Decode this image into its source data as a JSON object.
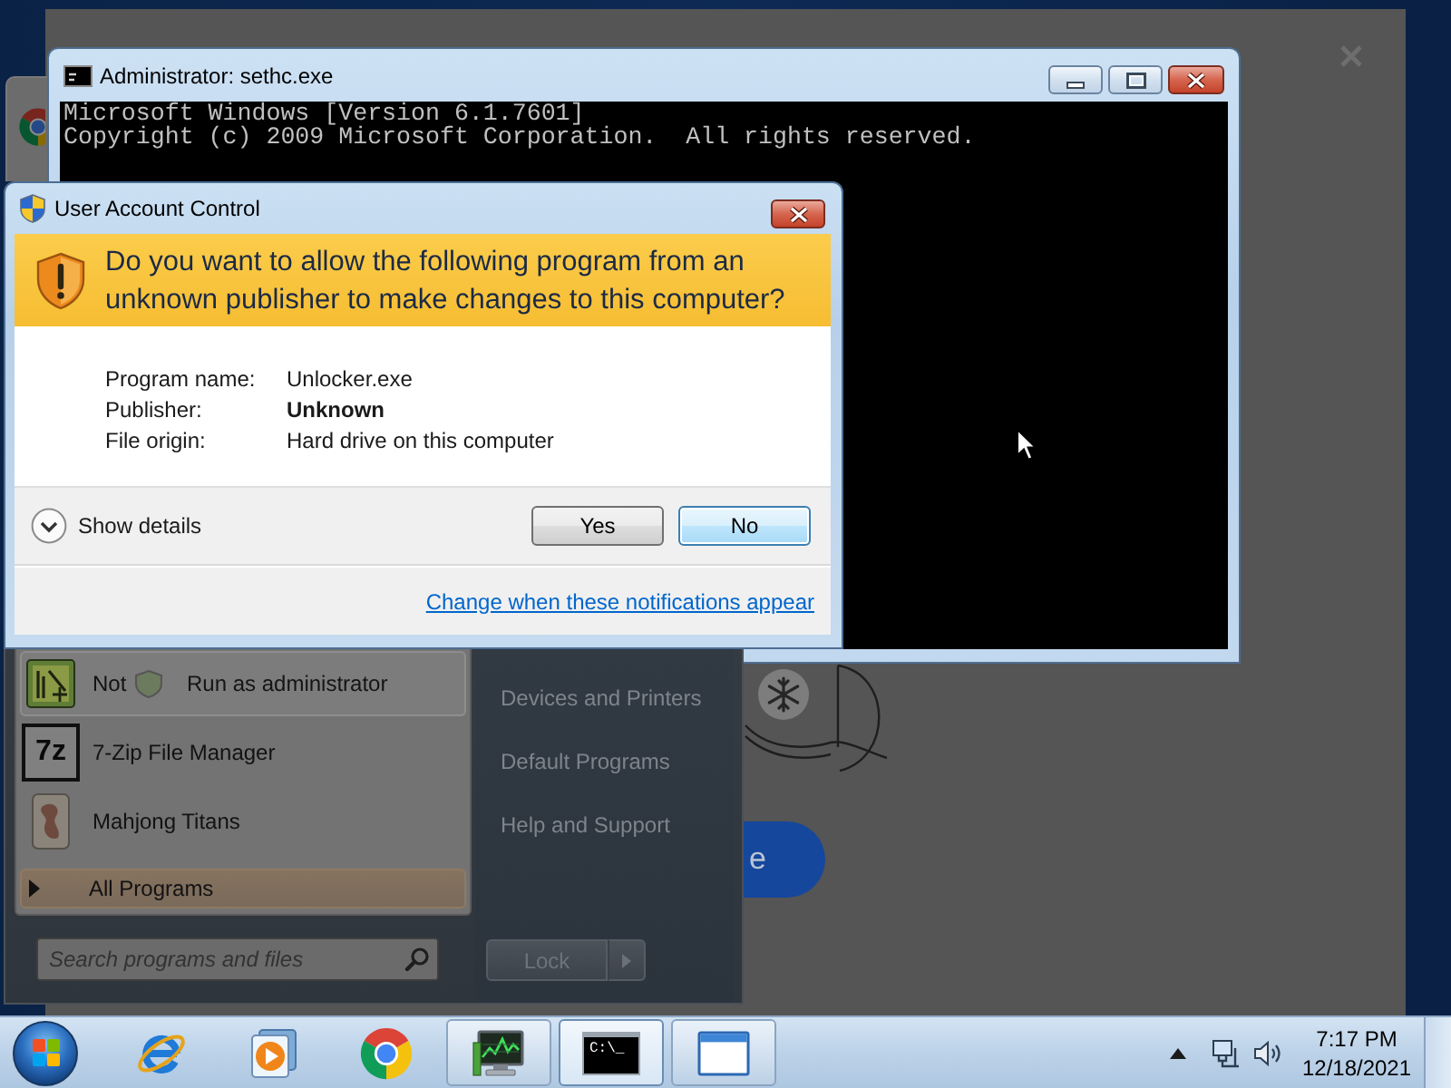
{
  "console_window": {
    "title": "Administrator: sethc.exe",
    "lines": [
      "Microsoft Windows [Version 6.1.7601]",
      "Copyright (c) 2009 Microsoft Corporation.  All rights reserved."
    ]
  },
  "uac_dialog": {
    "title": "User Account Control",
    "question": "Do you want to allow the following program from an unknown publisher to make changes to this computer?",
    "details": [
      {
        "label": "Program name:",
        "value": "Unlocker.exe",
        "bold": false
      },
      {
        "label": "Publisher:",
        "value": "Unknown",
        "bold": true
      },
      {
        "label": "File origin:",
        "value": "Hard drive on this computer",
        "bold": false
      }
    ],
    "show_details": {
      "label": "Show details",
      "expanded": false
    },
    "buttons": [
      {
        "label": "Yes",
        "focused": false
      },
      {
        "label": "No",
        "focused": true
      }
    ],
    "link": "Change when these notifications appear"
  },
  "start_menu": {
    "programs": [
      {
        "label": "Not",
        "highlighted": true
      },
      {
        "label": "7-Zip File Manager",
        "icon_label": "7z",
        "highlighted": false
      },
      {
        "label": "Mahjong Titans",
        "highlighted": false
      }
    ],
    "context_item": "Run as administrator",
    "all_programs": {
      "label": "All Programs",
      "highlighted": true
    },
    "search": {
      "placeholder": "Search programs and files"
    },
    "places": [
      "Devices and Printers",
      "Default Programs",
      "Help and Support"
    ],
    "power_button": "Lock"
  },
  "background_window": {
    "button_label": "e"
  },
  "taskbar": {
    "buttons": [
      {
        "running": false,
        "selected": false
      },
      {
        "running": false,
        "selected": false
      },
      {
        "running": false,
        "selected": false
      },
      {
        "running": true,
        "selected": false
      },
      {
        "running": true,
        "selected": true,
        "icon_label": "C:\\_"
      },
      {
        "running": true,
        "selected": false
      }
    ],
    "clock": {
      "time": "7:17 PM",
      "date": "12/18/2021"
    }
  }
}
